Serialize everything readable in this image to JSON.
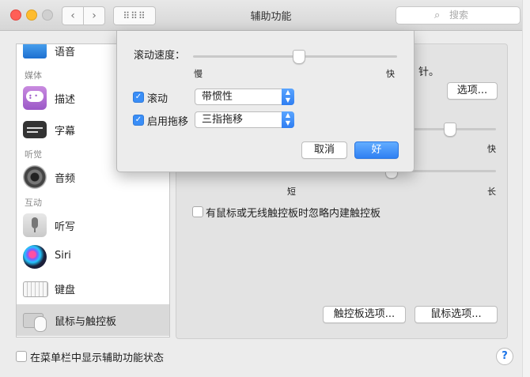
{
  "window": {
    "title": "辅助功能"
  },
  "search": {
    "placeholder": "搜索",
    "icon": "search-icon"
  },
  "sidebar": {
    "items": [
      {
        "label": "语音",
        "icon": "display-icon"
      },
      {
        "category": "媒体"
      },
      {
        "label": "描述",
        "icon": "speech-bubble-icon"
      },
      {
        "label": "字幕",
        "icon": "captions-icon"
      },
      {
        "category": "听觉"
      },
      {
        "label": "音频",
        "icon": "speaker-icon"
      },
      {
        "category": "互动"
      },
      {
        "label": "听写",
        "icon": "microphone-icon"
      },
      {
        "label": "Siri",
        "icon": "siri-icon"
      },
      {
        "label": "键盘",
        "icon": "keyboard-icon"
      },
      {
        "label": "鼠标与触控板",
        "icon": "mouse-trackpad-icon",
        "selected": true
      }
    ]
  },
  "pane": {
    "partial_text": "针。",
    "options_button": "选项...",
    "slider_a_right_label": "快",
    "slider_b_left_label": "短",
    "slider_b_right_label": "长",
    "ignore_trackpad_checkbox": "有鼠标或无线触控板时忽略内建触控板",
    "trackpad_options_button": "触控板选项...",
    "mouse_options_button": "鼠标选项..."
  },
  "dialog": {
    "scroll_speed_label": "滚动速度：",
    "slow_label": "慢",
    "fast_label": "快",
    "scroll_speed_level": 0.52,
    "scroll_checkbox_label": "滚动",
    "scroll_checked": true,
    "scroll_mode_value": "带惯性",
    "drag_checkbox_label": "启用拖移",
    "drag_checked": true,
    "drag_mode_value": "三指拖移",
    "cancel_button": "取消",
    "ok_button": "好"
  },
  "footer": {
    "show_status_checkbox": "在菜单栏中显示辅助功能状态",
    "help_button": "?"
  },
  "colors": {
    "accent": "#3a8ef7"
  }
}
